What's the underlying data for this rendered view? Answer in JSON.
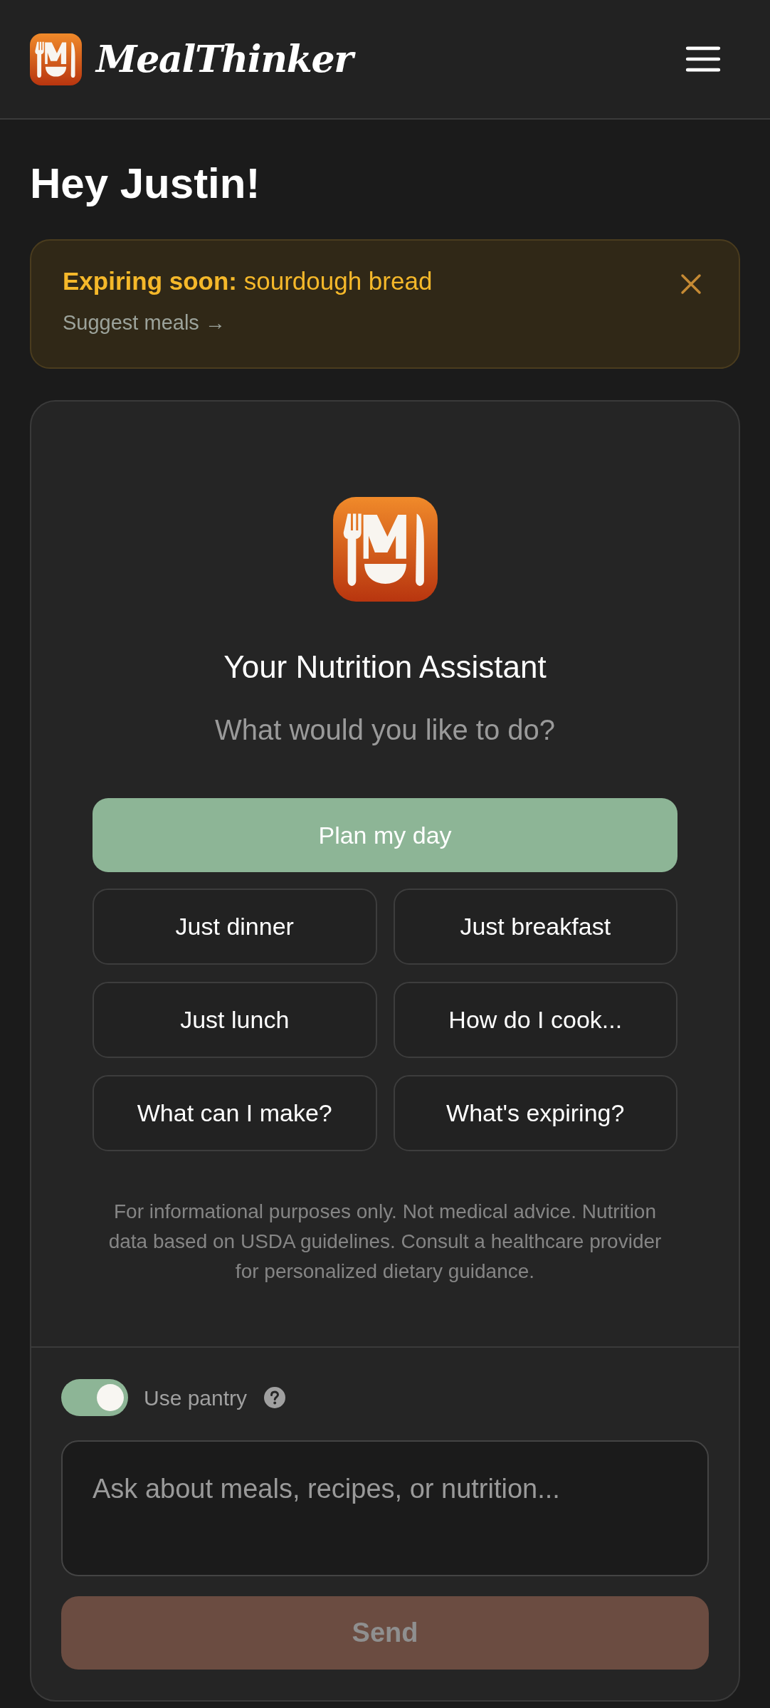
{
  "header": {
    "brand": "MealThinker"
  },
  "greeting": "Hey Justin!",
  "alert": {
    "label": "Expiring soon:",
    "item": "sourdough bread",
    "link": "Suggest meals →"
  },
  "assistant": {
    "title": "Your Nutrition Assistant",
    "subtitle": "What would you like to do?",
    "actions": [
      {
        "label": "Plan my day",
        "kind": "primary"
      },
      {
        "label": "Just dinner",
        "kind": "secondary"
      },
      {
        "label": "Just breakfast",
        "kind": "secondary"
      },
      {
        "label": "Just lunch",
        "kind": "secondary"
      },
      {
        "label": "How do I cook...",
        "kind": "secondary"
      },
      {
        "label": "What can I make?",
        "kind": "secondary"
      },
      {
        "label": "What's expiring?",
        "kind": "secondary"
      }
    ],
    "disclaimer": "For informational purposes only. Not medical advice. Nutrition data based on USDA guidelines. Consult a healthcare provider for personalized dietary guidance."
  },
  "pantry_toggle": {
    "label": "Use pantry",
    "on": true
  },
  "input": {
    "placeholder": "Ask about meals, recipes, or nutrition..."
  },
  "send": {
    "label": "Send",
    "disabled": true
  }
}
